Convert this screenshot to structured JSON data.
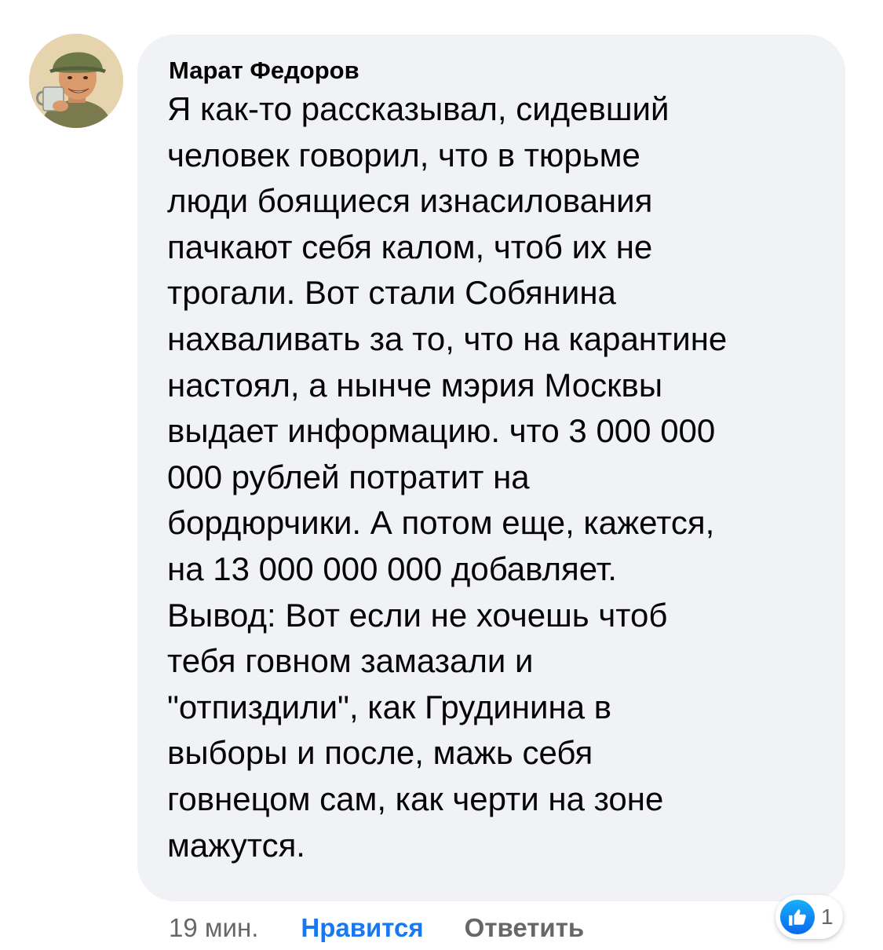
{
  "comment": {
    "author": "Марат Федоров",
    "text_lines": [
      "Я как-то рассказывал, сидевший",
      "человек говорил, что в тюрьме",
      "люди боящиеся изнасилования",
      "пачкают себя калом, чтоб их не",
      "трогали. Вот стали Собянина",
      "нахваливать за то, что на карантине",
      "настоял, а нынче мэрия Москвы",
      "выдает информацию. что 3 000 000",
      "000 рублей потратит на",
      "бордюрчики. А потом еще, кажется,",
      "на 13 000 000 000 добавляет.",
      "Вывод: Вот если не хочешь чтоб",
      "тебя говном замазали и",
      "\"отпиздили\", как Грудинина в",
      "выборы и после, мажь себя",
      "говнецом сам, как черти на зоне",
      "мажутся."
    ]
  },
  "actions": {
    "time": "19 мин.",
    "like": "Нравится",
    "reply": "Ответить"
  },
  "reactions": {
    "icon": "like-icon",
    "count": "1"
  },
  "colors": {
    "bubble": "#f0f2f5",
    "like_active": "#1877f2",
    "secondary_text": "#65676b"
  }
}
